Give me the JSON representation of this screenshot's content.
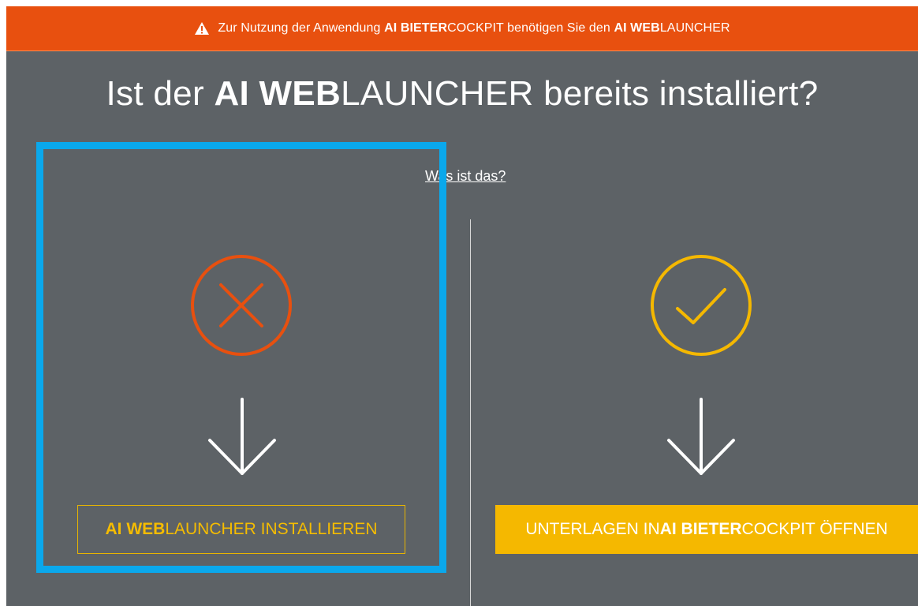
{
  "banner": {
    "prefix": "Zur Nutzung der Anwendung ",
    "app_bold": "AI BIETER",
    "app_rest": "COCKPIT",
    "middle": " benötigen Sie den ",
    "launcher_bold": "AI WEB",
    "launcher_rest": "LAUNCHER",
    "icon": "warning-icon"
  },
  "headline": {
    "prefix": "Ist der ",
    "bold": "AI WEB",
    "rest": "LAUNCHER bereits installiert?"
  },
  "help_link": "Was ist das?",
  "left_option": {
    "status_icon": "x-circle-icon",
    "arrow_icon": "arrow-down-icon",
    "button_bold": "AI WEB",
    "button_rest": "LAUNCHER INSTALLIEREN"
  },
  "right_option": {
    "status_icon": "check-circle-icon",
    "arrow_icon": "arrow-down-icon",
    "button_prefix": "UNTERLAGEN IN ",
    "button_bold": "AI BIETER",
    "button_rest": "COCKPIT ÖFFNEN"
  },
  "colors": {
    "banner": "#e8500f",
    "background": "#5d6266",
    "accent_yellow": "#f5b800",
    "error_orange": "#e8500f",
    "highlight_blue": "#0aa8ec"
  }
}
